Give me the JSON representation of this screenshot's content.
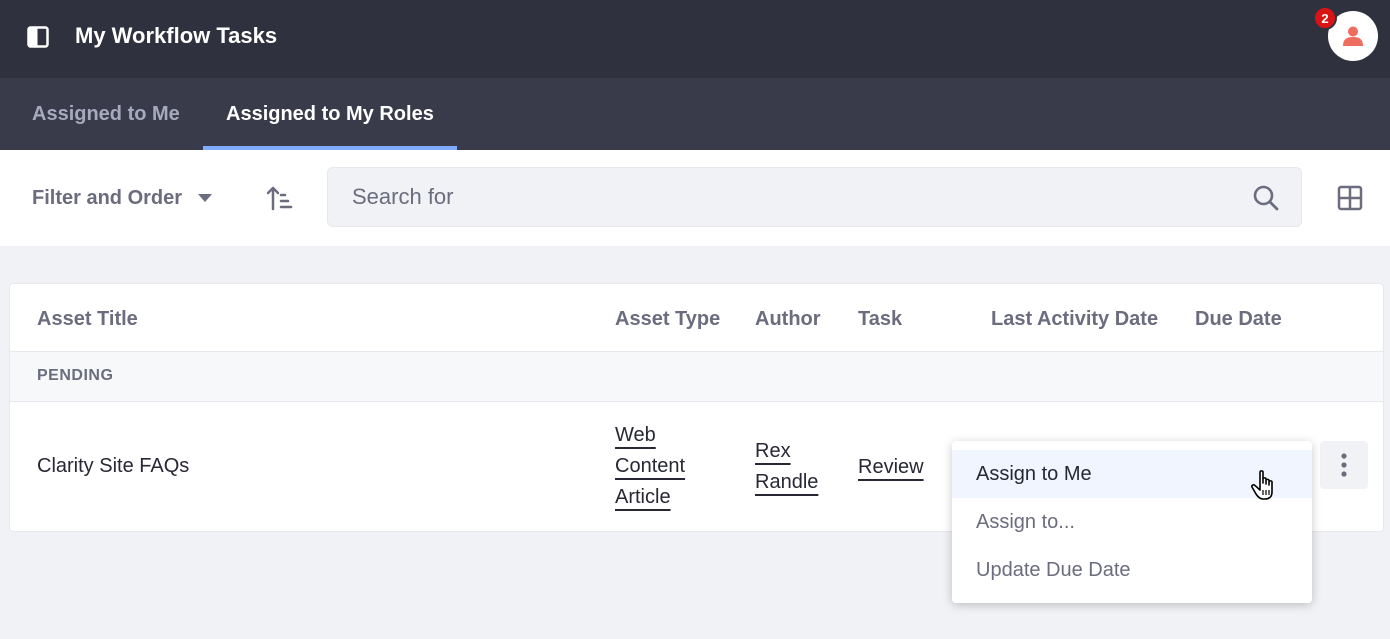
{
  "header": {
    "title": "My Workflow Tasks",
    "notification_count": "2",
    "toggle_icon": "panel-toggle-icon",
    "avatar_icon": "user-icon"
  },
  "tabs": [
    {
      "label": "Assigned to Me",
      "active": false
    },
    {
      "label": "Assigned to My Roles",
      "active": true
    }
  ],
  "toolbar": {
    "filter_label": "Filter and Order",
    "search_placeholder": "Search for",
    "search_value": ""
  },
  "table": {
    "columns": [
      "Asset Title",
      "Asset Type",
      "Author",
      "Task",
      "Last Activity Date",
      "Due Date"
    ],
    "group_label": "PENDING",
    "rows": [
      {
        "asset_title": "Clarity Site FAQs",
        "asset_type": "Web Content Article",
        "author": "Rex Randle",
        "task": "Review",
        "last_activity_date": "",
        "due_date": ""
      }
    ]
  },
  "menu": {
    "items": [
      "Assign to Me",
      "Assign to...",
      "Update Due Date"
    ]
  },
  "colors": {
    "header_bg": "#30313f",
    "tabbar_bg": "#393a4a",
    "tab_indicator": "#80acff",
    "badge": "#da1414",
    "avatar_figure": "#ef6d5e"
  }
}
